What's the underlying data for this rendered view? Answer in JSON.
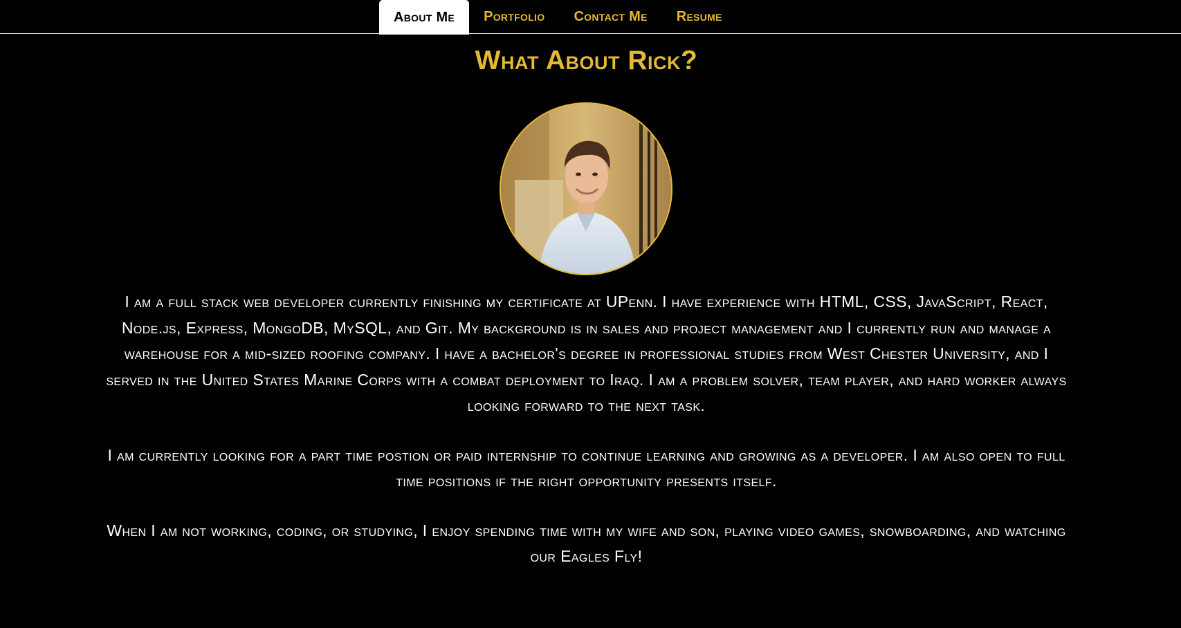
{
  "nav": {
    "items": [
      {
        "label": "About Me",
        "active": true
      },
      {
        "label": "Portfolio",
        "active": false
      },
      {
        "label": "Contact Me",
        "active": false
      },
      {
        "label": "Resume",
        "active": false
      }
    ]
  },
  "page": {
    "title": "What About Rick?"
  },
  "bio": {
    "paragraphs": [
      "I am a full stack web developer currently finishing my certificate at UPenn. I have experience with HTML, CSS, JavaScript, React, Node.js, Express, MongoDB, MySQL, and Git. My background is in sales and project management and I currently run and manage a warehouse for a mid-sized roofing company. I have a bachelor's degree in professional studies from West Chester University, and I served in the United States Marine Corps with a combat deployment to Iraq. I am a problem solver, team player, and hard worker always looking forward to the next task.",
      "I am currently looking for a part time postion or paid internship to continue learning and growing as a developer. I am also open to full time positions if the right opportunity presents itself.",
      "When I am not working, coding, or studying, I enjoy spending time with my wife and son, playing video games, snowboarding, and watching our Eagles Fly!"
    ]
  },
  "colors": {
    "accent": "#e4b935",
    "background": "#000000",
    "text": "#ffffff"
  }
}
